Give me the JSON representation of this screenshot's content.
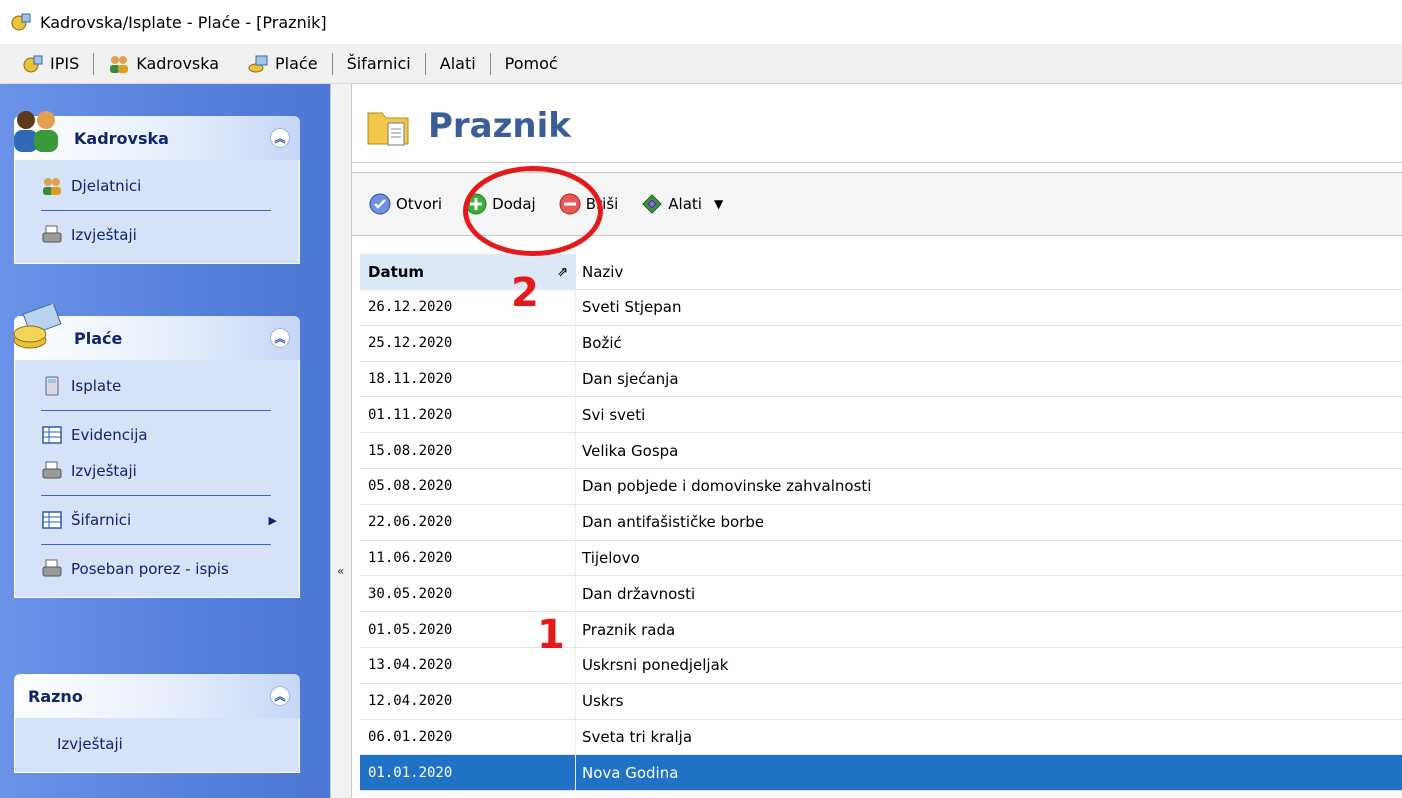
{
  "window": {
    "title": "Kadrovska/Isplate - Plaće - [Praznik]"
  },
  "menu": {
    "items": [
      {
        "label": "IPIS",
        "icon": "ipis-icon"
      },
      {
        "label": "Kadrovska",
        "icon": "people-icon"
      },
      {
        "label": "Plaće",
        "icon": "payroll-icon"
      },
      {
        "label": "Šifarnici"
      },
      {
        "label": "Alati"
      },
      {
        "label": "Pomoć"
      }
    ]
  },
  "sidebar": {
    "kadrovska": {
      "title": "Kadrovska",
      "items": [
        {
          "label": "Djelatnici"
        },
        {
          "label": "Izvještaji"
        }
      ]
    },
    "place": {
      "title": "Plaće",
      "items": [
        {
          "label": "Isplate"
        },
        {
          "label": "Evidencija"
        },
        {
          "label": "Izvještaji"
        },
        {
          "label": "Šifarnici"
        },
        {
          "label": "Poseban porez - ispis"
        }
      ]
    },
    "razno": {
      "title": "Razno",
      "items": [
        {
          "label": "Izvještaji"
        }
      ]
    }
  },
  "page": {
    "title": "Praznik"
  },
  "toolbar": {
    "open_label": "Otvori",
    "add_label": "Dodaj",
    "delete_label": "Briši",
    "tools_label": "Alati"
  },
  "grid": {
    "columns": {
      "datum": "Datum",
      "naziv": "Naziv"
    },
    "rows": [
      {
        "datum": "26.12.2020",
        "naziv": "Sveti Stjepan"
      },
      {
        "datum": "25.12.2020",
        "naziv": "Božić"
      },
      {
        "datum": "18.11.2020",
        "naziv": "Dan sjećanja"
      },
      {
        "datum": "01.11.2020",
        "naziv": "Svi sveti"
      },
      {
        "datum": "15.08.2020",
        "naziv": "Velika Gospa"
      },
      {
        "datum": "05.08.2020",
        "naziv": "Dan pobjede i domovinske zahvalnosti"
      },
      {
        "datum": "22.06.2020",
        "naziv": "Dan antifašističke borbe"
      },
      {
        "datum": "11.06.2020",
        "naziv": "Tijelovo"
      },
      {
        "datum": "30.05.2020",
        "naziv": "Dan državnosti"
      },
      {
        "datum": "01.05.2020",
        "naziv": "Praznik rada"
      },
      {
        "datum": "13.04.2020",
        "naziv": "Uskrsni ponedjeljak"
      },
      {
        "datum": "12.04.2020",
        "naziv": "Uskrs"
      },
      {
        "datum": "06.01.2020",
        "naziv": "Sveta tri kralja"
      },
      {
        "datum": "01.01.2020",
        "naziv": "Nova Godina",
        "selected": true
      }
    ]
  },
  "annotations": {
    "step1": "1",
    "step2": "2"
  },
  "colors": {
    "sidebar": "#5580db",
    "selection": "#1f72c6",
    "annotation": "#e3191c",
    "title": "#3b5e99"
  }
}
